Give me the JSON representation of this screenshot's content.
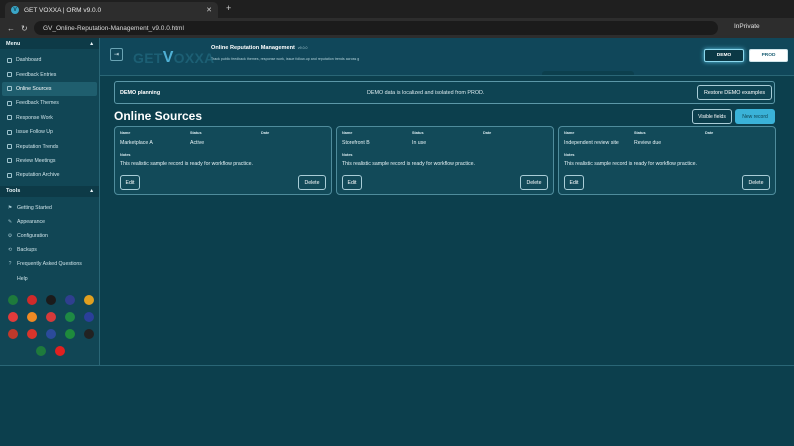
{
  "browser": {
    "tab_title": "GET VOXXA | ORM v9.0.0",
    "url": "GV_Online-Reputation-Management_v9.0.0.html",
    "private_label": "InPrivate"
  },
  "sidebar": {
    "menu_title": "Menu",
    "menu_items": [
      {
        "label": "Dashboard"
      },
      {
        "label": "Feedback Entries"
      },
      {
        "label": "Online Sources"
      },
      {
        "label": "Feedback Themes"
      },
      {
        "label": "Response Work"
      },
      {
        "label": "Issue Follow Up"
      },
      {
        "label": "Reputation Trends"
      },
      {
        "label": "Review Meetings"
      },
      {
        "label": "Reputation Archive"
      }
    ],
    "active_index": 2,
    "tools_title": "Tools",
    "tool_items": [
      {
        "label": "Getting Started",
        "icon": "flag-icon"
      },
      {
        "label": "Appearance",
        "icon": "palette-icon"
      },
      {
        "label": "Configuration",
        "icon": "gear-icon"
      },
      {
        "label": "Backups",
        "icon": "backup-icon"
      },
      {
        "label": "Frequently Asked Questions",
        "icon": "question-icon"
      },
      {
        "label": "Help",
        "icon": ""
      }
    ]
  },
  "header": {
    "logo_get": "GET",
    "logo_v": "V",
    "logo_rest": "OXXA",
    "title": "Online Reputation Management",
    "version": "v9.0.0",
    "subtitle": "Track public feedback themes, response work, issue follow-up and reputation trends across g",
    "env_demo": "DEMO",
    "env_prod": "PROD"
  },
  "banner": {
    "title": "DEMO planning",
    "message": "DEMO data is localized and isolated from PROD.",
    "restore_label": "Restore DEMO examples"
  },
  "section": {
    "title": "Online Sources",
    "visible_fields_label": "Visible fields",
    "new_record_label": "New record"
  },
  "card_labels": {
    "name": "Name",
    "status": "Status",
    "date": "Date",
    "notes": "Notes",
    "edit": "Edit",
    "delete": "Delete"
  },
  "cards": [
    {
      "name": "Marketplace A",
      "status": "Active",
      "date": "",
      "notes": "This realistic sample record is ready for workflow practice."
    },
    {
      "name": "Storefront B",
      "status": "In use",
      "date": "",
      "notes": "This realistic sample record is ready for workflow practice."
    },
    {
      "name": "Independent review site",
      "status": "Review due",
      "date": "",
      "notes": "This realistic sample record is ready for workflow practice."
    }
  ],
  "languages": {
    "colors": [
      "#1e7a3c",
      "#d02a2a",
      "#1b1b1b",
      "#2f3f8f",
      "#e0a020",
      "#e23b3b",
      "#f08a24",
      "#d63a3a",
      "#1e8a44",
      "#2a3f9a",
      "#c0392b",
      "#d9342b",
      "#2b4b9b",
      "#1e8a3c",
      "#222222",
      "#1e7a3c",
      "#e02020"
    ]
  }
}
